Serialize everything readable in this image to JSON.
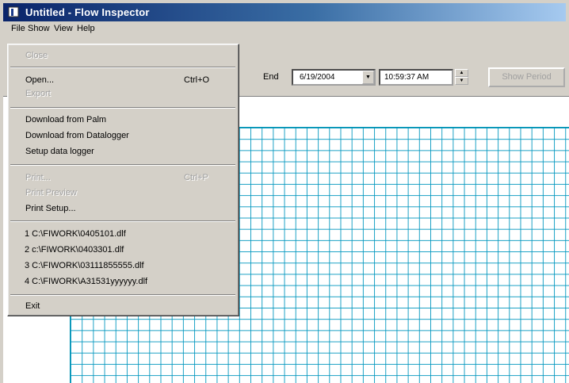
{
  "window": {
    "title": "Untitled - Flow Inspector"
  },
  "menubar": [
    "File",
    "Show",
    "View",
    "Help"
  ],
  "toolbar": {
    "end_label": "End",
    "end_date": "6/19/2004",
    "end_time": "10:59:37 AM",
    "show_period_label": "Show Period"
  },
  "file_menu": {
    "close": "Close",
    "open": "Open...",
    "open_shortcut": "Ctrl+O",
    "export": "Export",
    "download_palm": "Download from Palm",
    "download_datalogger": "Download from Datalogger",
    "setup_datalogger": "Setup data logger",
    "print": "Print...",
    "print_shortcut": "Ctrl+P",
    "print_preview": "Print Preview",
    "print_setup": "Print Setup...",
    "recent": [
      "1 C:\\FIWORK\\0405101.dlf",
      "2 c:\\FIWORK\\0403301.dlf",
      "3 C:\\FIWORK\\03111855555.dlf",
      "4 C:\\FIWORK\\A31531yyyyyy.dlf"
    ],
    "exit": "Exit"
  },
  "colors": {
    "title_bar": "#0a246a",
    "grid": "#0096be",
    "selection": "#0a246a"
  }
}
